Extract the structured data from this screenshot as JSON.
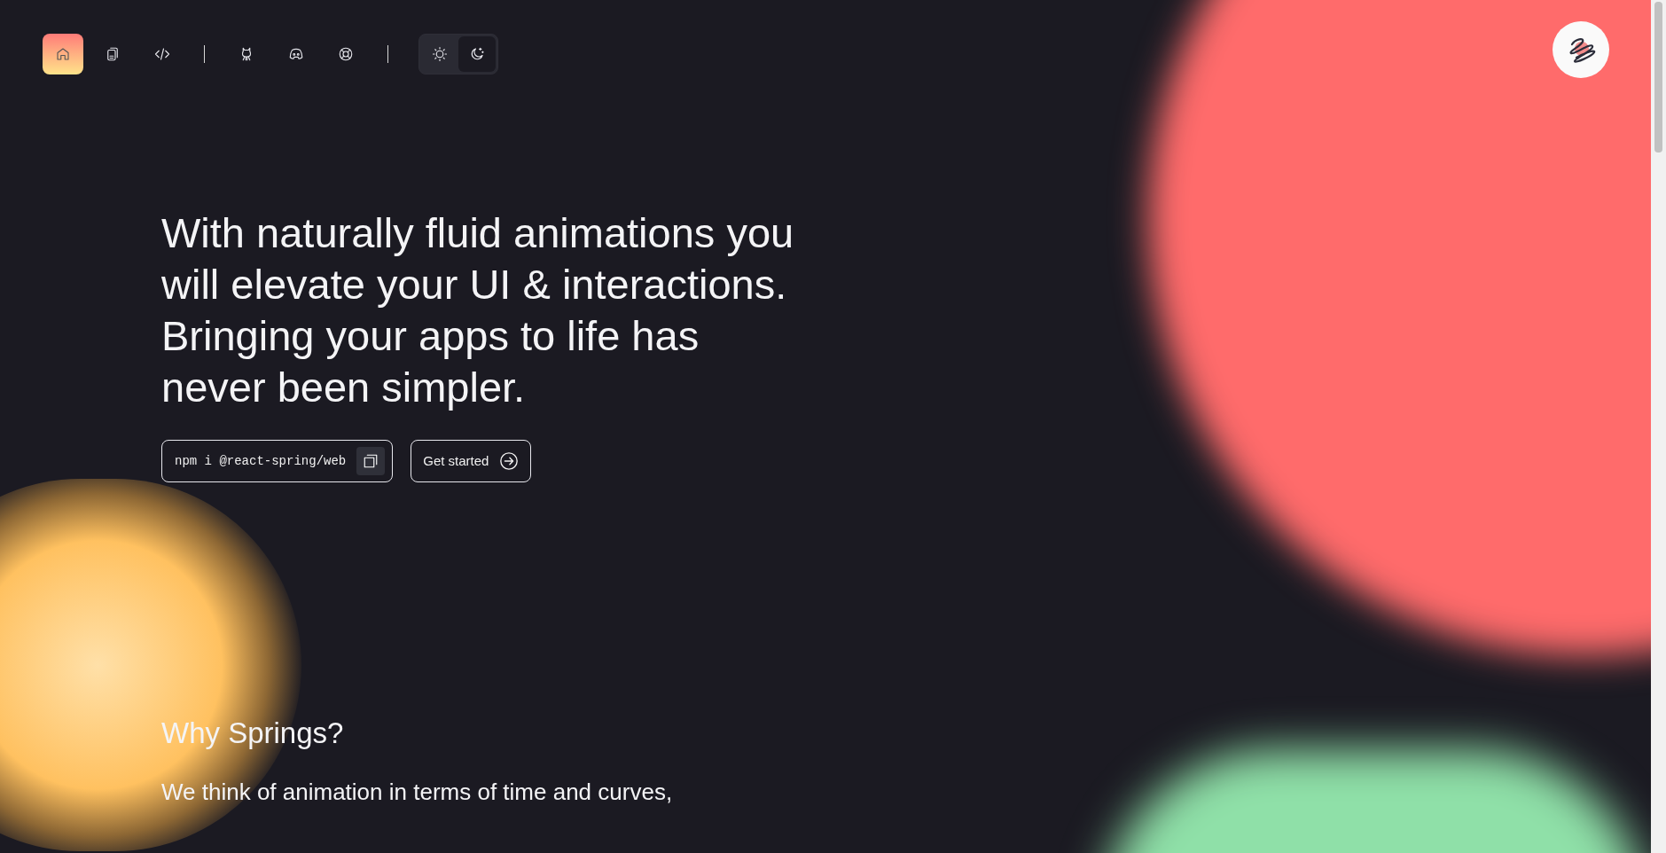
{
  "nav": {
    "items": [
      {
        "kind": "home",
        "selected": true
      },
      {
        "kind": "docs",
        "selected": false
      },
      {
        "kind": "code",
        "selected": false
      },
      {
        "kind": "divider"
      },
      {
        "kind": "github",
        "selected": false
      },
      {
        "kind": "discord",
        "selected": false
      },
      {
        "kind": "support",
        "selected": false
      },
      {
        "kind": "divider"
      }
    ],
    "theme_toggle": [
      {
        "kind": "light",
        "selected": false
      },
      {
        "kind": "dark",
        "selected": true
      }
    ]
  },
  "hero": {
    "headline": "With naturally fluid animations you will elevate your UI & interactions. Bringing your apps to life has never been simpler.",
    "install_command": "npm i @react-spring/web",
    "cta": "Get started"
  },
  "section": {
    "heading": "Why Springs?",
    "paragraph": "We think of animation in terms of time and curves,"
  }
}
